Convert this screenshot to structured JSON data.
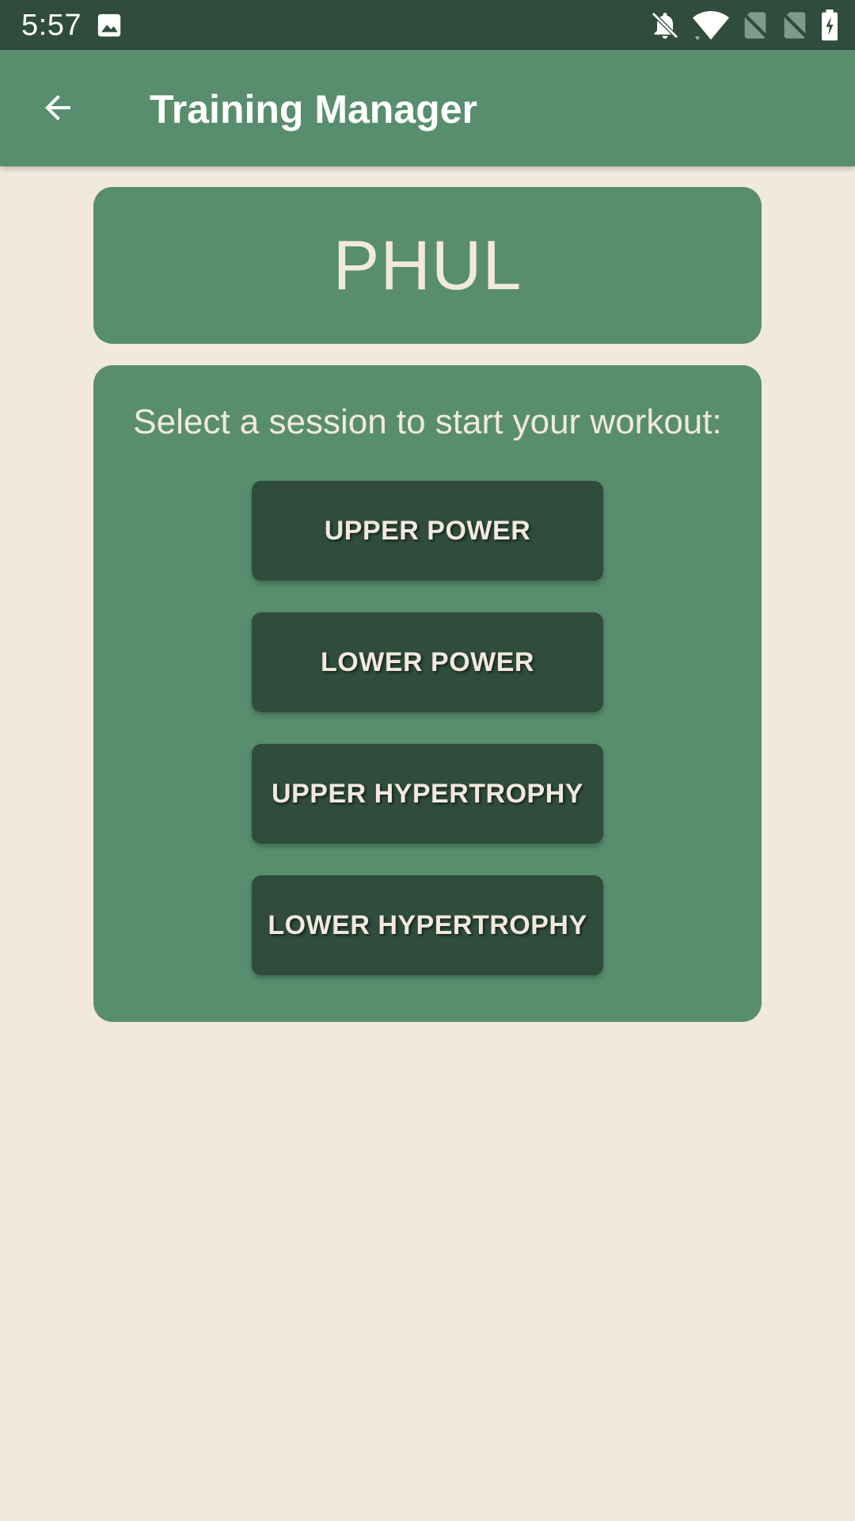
{
  "status_bar": {
    "time": "5:57",
    "icons": [
      "gallery-icon",
      "notifications-off-icon",
      "wifi-icon",
      "no-sim-icon",
      "no-sim-icon",
      "battery-charging-icon"
    ]
  },
  "app_bar": {
    "back_icon": "arrow-back-icon",
    "title": "Training Manager"
  },
  "program": {
    "name": "PHUL"
  },
  "sessions": {
    "prompt": "Select a session to start your workout:",
    "buttons": [
      {
        "label": "UPPER POWER"
      },
      {
        "label": "LOWER POWER"
      },
      {
        "label": "UPPER HYPERTROPHY"
      },
      {
        "label": "LOWER HYPERTROPHY"
      }
    ]
  },
  "colors": {
    "status_bar": "#2F4C3D",
    "primary": "#588E6E",
    "button": "#2F4C3D",
    "background": "#F1E9DE",
    "text_light": "#F1E9DE"
  }
}
